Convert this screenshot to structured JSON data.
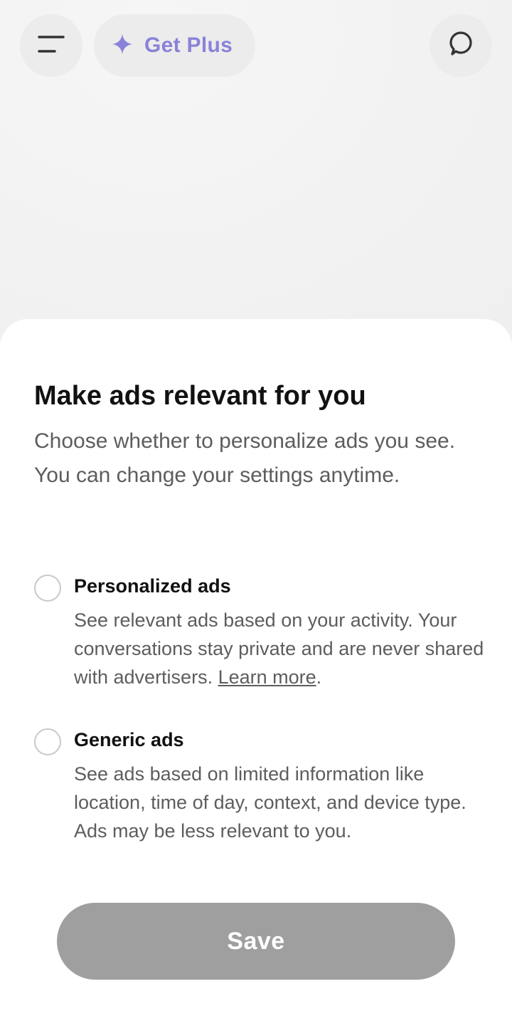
{
  "header": {
    "menu_icon": "hamburger-menu-icon",
    "plus_button": {
      "label": "Get Plus",
      "icon": "sparkle-icon",
      "color": "#8a82d8"
    },
    "new_chat_icon": "chat-bubble-icon"
  },
  "sheet": {
    "title": "Make ads relevant for you",
    "description": "Choose whether to personalize ads you see. You can change your settings anytime.",
    "options": [
      {
        "title": "Personalized ads",
        "description": "See relevant ads based on your activity. Your conversations stay private and are never shared with advertisers.",
        "link_label": "Learn more",
        "link_suffix": ".",
        "selected": false
      },
      {
        "title": "Generic ads",
        "description": "See ads based on limited information like location, time of day, context, and device type. Ads may be less relevant to you.",
        "selected": false
      }
    ],
    "save_label": "Save",
    "save_color": "#9f9f9f"
  }
}
